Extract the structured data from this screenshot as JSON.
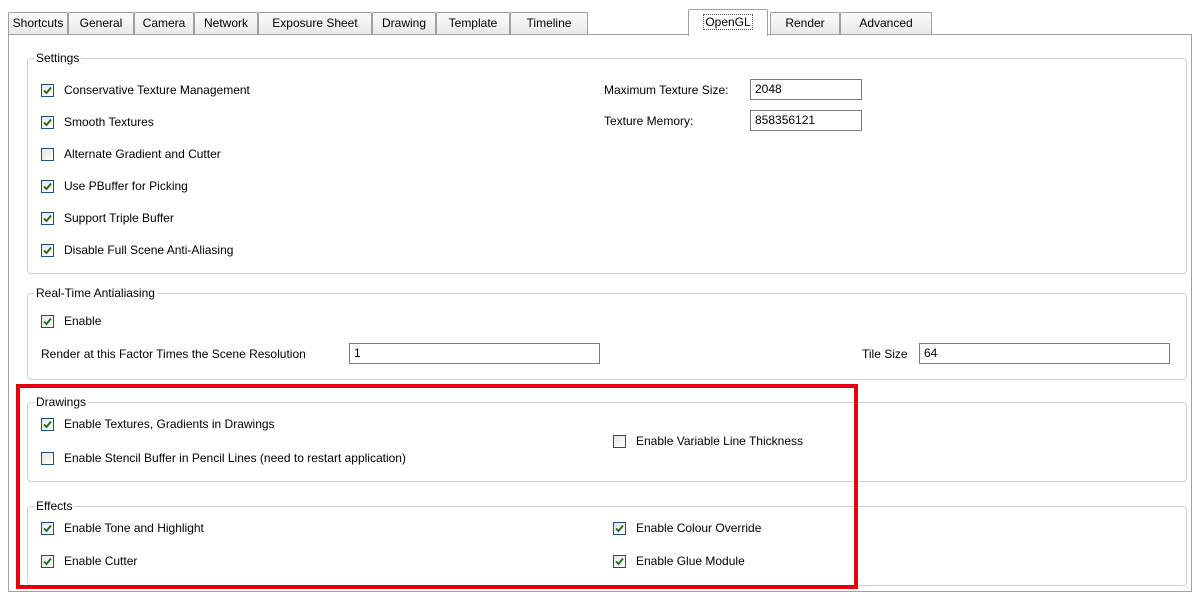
{
  "tabs": [
    {
      "label": "Shortcuts"
    },
    {
      "label": "General"
    },
    {
      "label": "Camera"
    },
    {
      "label": "Network"
    },
    {
      "label": "Exposure Sheet"
    },
    {
      "label": "Drawing"
    },
    {
      "label": "Template"
    },
    {
      "label": "Timeline"
    },
    {
      "label": "OpenGL"
    },
    {
      "label": "Render"
    },
    {
      "label": "Advanced"
    }
  ],
  "active_tab": "OpenGL",
  "settings": {
    "title": "Settings",
    "options": [
      {
        "label": "Conservative Texture Management",
        "checked": true
      },
      {
        "label": "Smooth Textures",
        "checked": true
      },
      {
        "label": "Alternate Gradient and Cutter",
        "checked": false
      },
      {
        "label": "Use PBuffer for Picking",
        "checked": true
      },
      {
        "label": "Support Triple Buffer",
        "checked": true
      },
      {
        "label": "Disable Full Scene Anti-Aliasing",
        "checked": true
      }
    ],
    "max_texture_label": "Maximum Texture Size:",
    "max_texture_value": "2048",
    "texture_memory_label": "Texture Memory:",
    "texture_memory_value": "858356121"
  },
  "realtime": {
    "title": "Real-Time Antialiasing",
    "enable_label": "Enable",
    "enable_checked": true,
    "factor_label": "Render at this Factor Times the Scene Resolution",
    "factor_value": "1",
    "tile_label": "Tile Size",
    "tile_value": "64"
  },
  "drawings": {
    "title": "Drawings",
    "textures": {
      "label": "Enable Textures, Gradients in Drawings",
      "checked": true
    },
    "stencil": {
      "label": "Enable Stencil Buffer in Pencil Lines (need to restart application)",
      "checked": false
    },
    "variable": {
      "label": "Enable Variable Line Thickness",
      "checked": false
    }
  },
  "effects": {
    "title": "Effects",
    "tone": {
      "label": "Enable Tone and Highlight",
      "checked": true
    },
    "cutter": {
      "label": "Enable Cutter",
      "checked": true
    },
    "colour": {
      "label": "Enable Colour Override",
      "checked": true
    },
    "glue": {
      "label": "Enable Glue Module",
      "checked": true
    }
  },
  "highlight_color": "#e8000e",
  "checkbox_border_color": "#1c5180",
  "checkmark_color": "#1c6b1c"
}
